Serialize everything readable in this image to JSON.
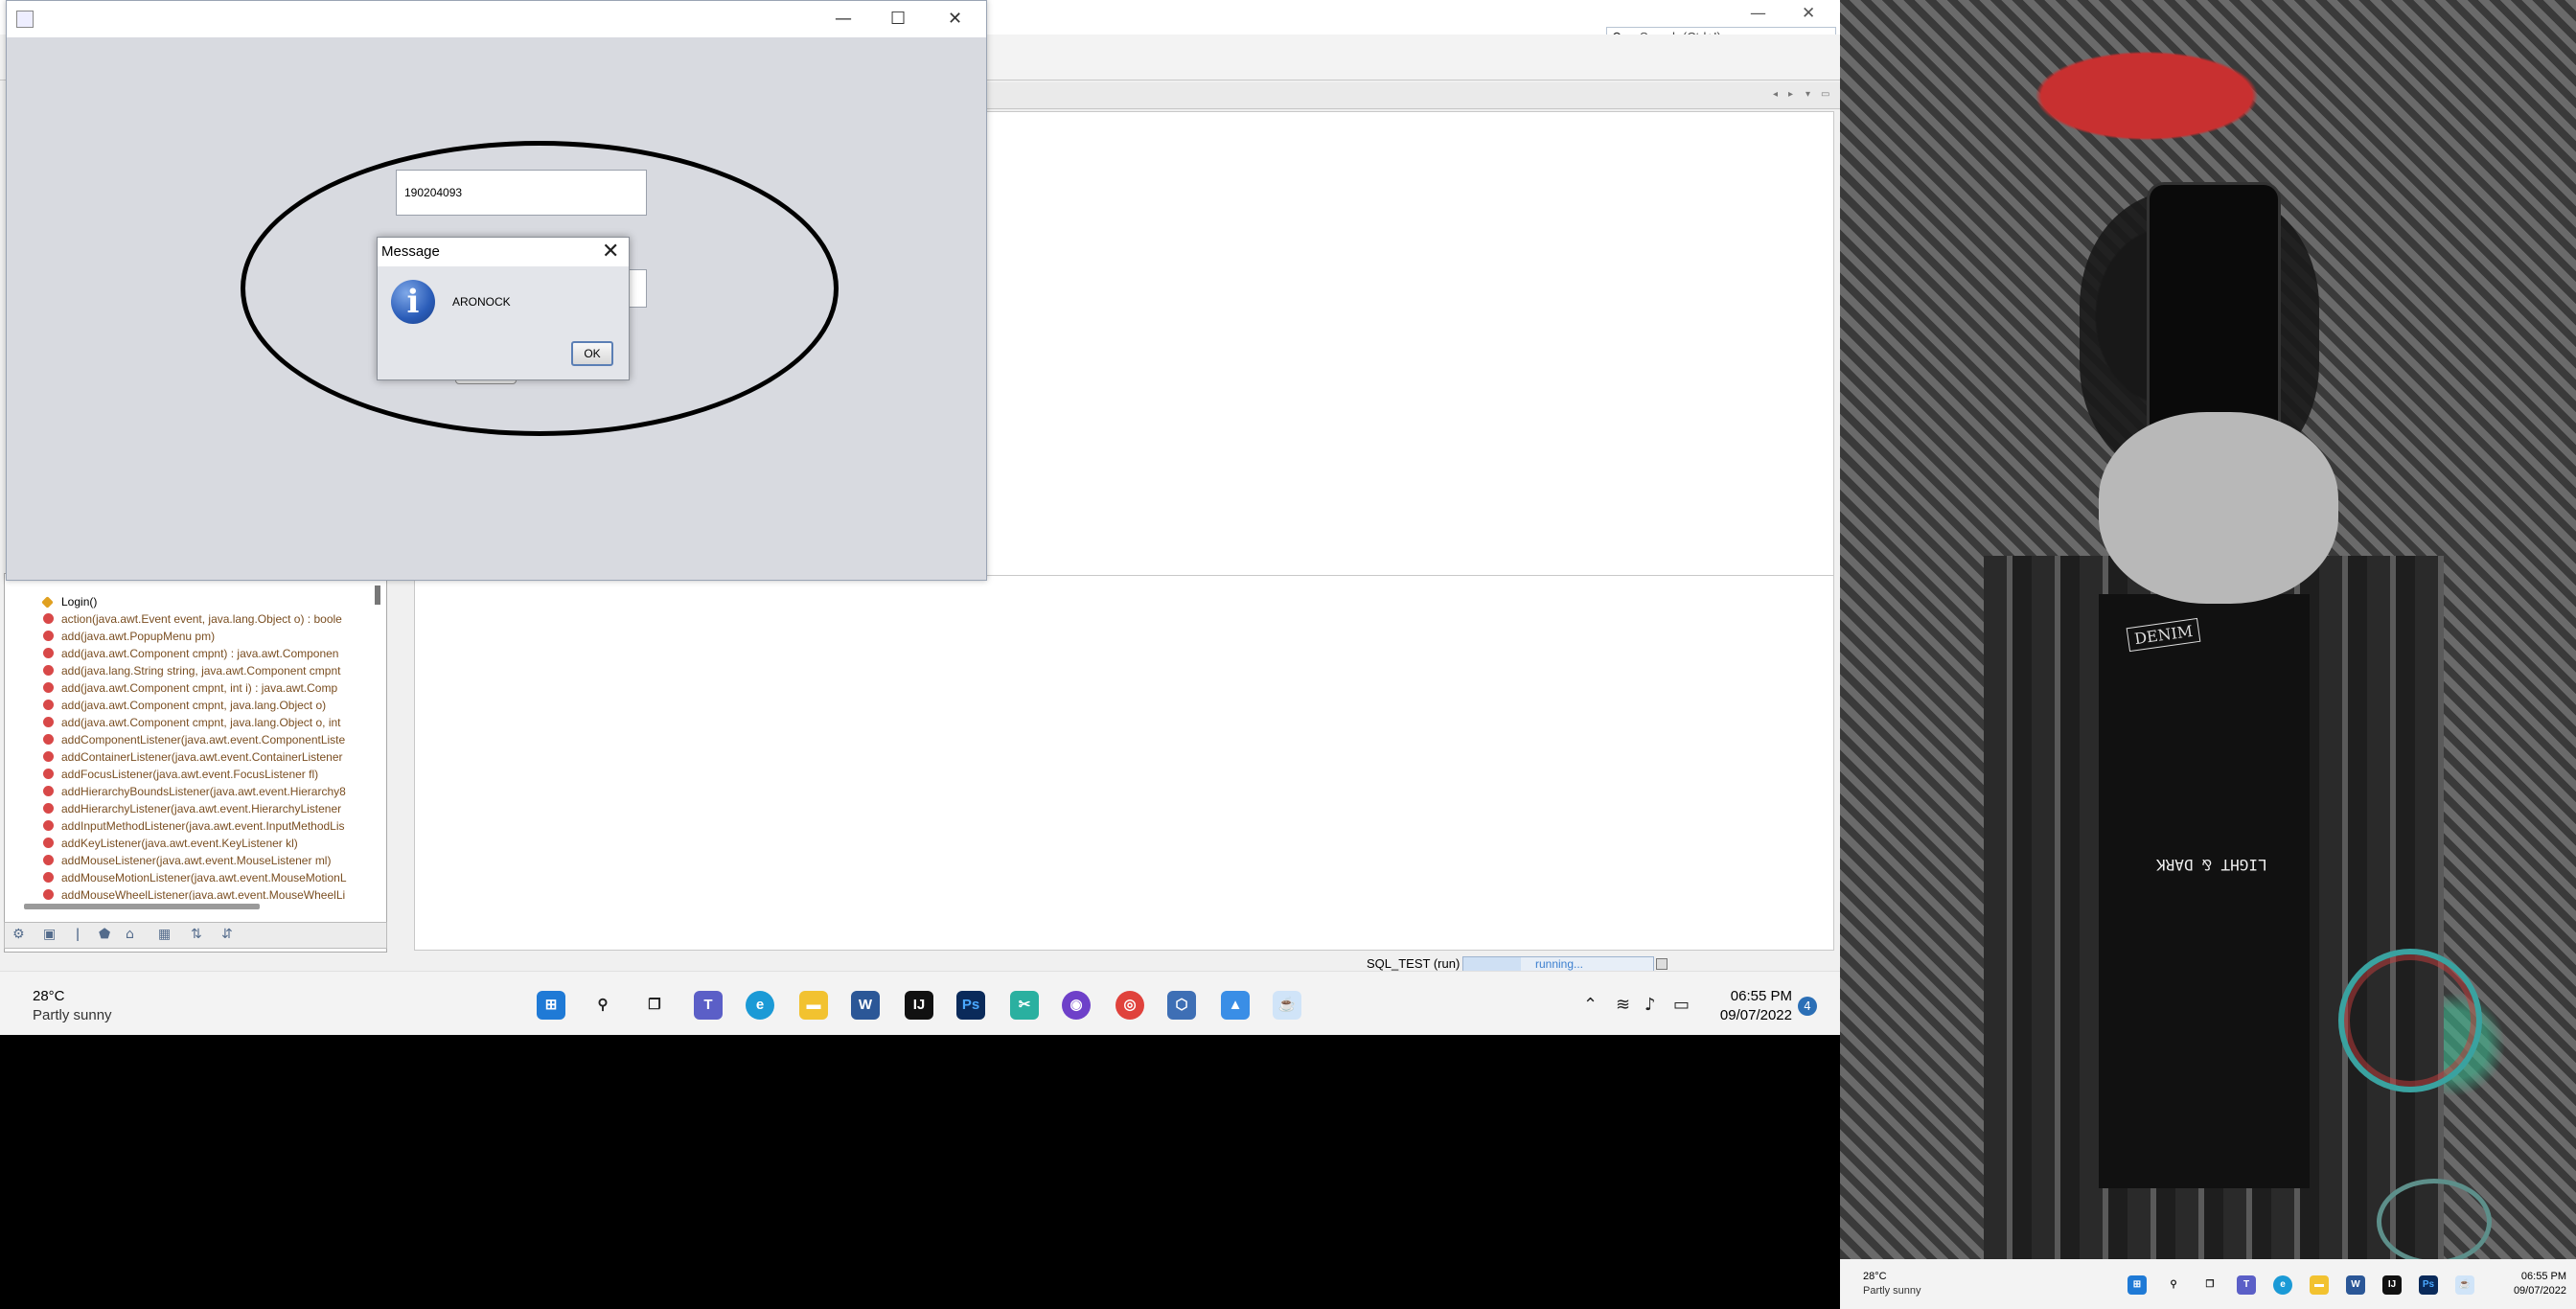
{
  "ide": {
    "search_placeholder": "Search (Ctrl+I)",
    "status_project": "SQL_TEST (run)",
    "status_progress_text": "running...",
    "navigator_items": [
      "Login()",
      "action(java.awt.Event event, java.lang.Object o) : boole",
      "add(java.awt.PopupMenu pm)",
      "add(java.awt.Component cmpnt) : java.awt.Componen",
      "add(java.lang.String string, java.awt.Component cmpnt",
      "add(java.awt.Component cmpnt, int i) : java.awt.Comp",
      "add(java.awt.Component cmpnt, java.lang.Object o)",
      "add(java.awt.Component cmpnt, java.lang.Object o, int",
      "addComponentListener(java.awt.event.ComponentListe",
      "addContainerListener(java.awt.event.ContainerListener",
      "addFocusListener(java.awt.event.FocusListener fl)",
      "addHierarchyBoundsListener(java.awt.event.Hierarchy8",
      "addHierarchyListener(java.awt.event.HierarchyListener",
      "addInputMethodListener(java.awt.event.InputMethodLis",
      "addKeyListener(java.awt.event.KeyListener kl)",
      "addMouseListener(java.awt.event.MouseListener ml)",
      "addMouseMotionListener(java.awt.event.MouseMotionL",
      "addMouseWheelListener(java.awt.event.MouseWheelLi"
    ]
  },
  "login_window": {
    "username_value": "190204093"
  },
  "dialog": {
    "title": "Message",
    "message": "ARONOCK",
    "ok_label": "OK",
    "close_glyph": "✕",
    "icon_glyph": "i"
  },
  "taskbar": {
    "weather_temp": "28°C",
    "weather_desc": "Partly sunny",
    "time": "06:55 PM",
    "date": "09/07/2022",
    "notification_count": "4",
    "apps": [
      "start",
      "search",
      "task-view",
      "teams",
      "edge",
      "file-explorer",
      "word",
      "intellij",
      "photoshop",
      "snip",
      "github",
      "chrome",
      "virtualbox",
      "photos",
      "java"
    ]
  },
  "photo": {
    "shirt_text_1": "DENIM",
    "shirt_text_2": "LIGHT & DARK"
  },
  "colors": {
    "accent": "#2b6fb6",
    "progress_text": "#3c7fcf",
    "method_text": "#7a4e21",
    "method_dot": "#d84848"
  }
}
